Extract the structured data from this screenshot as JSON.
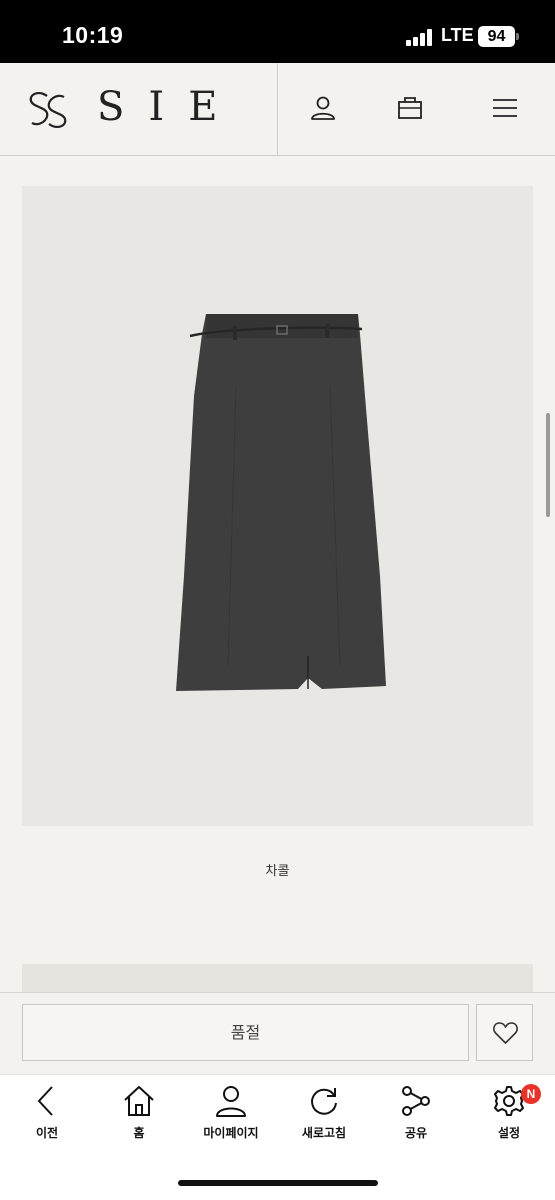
{
  "status_bar": {
    "time": "10:19",
    "network": "LTE",
    "battery": "94"
  },
  "header": {
    "logo_text": "SIE",
    "icons": [
      "account-icon",
      "shopping-bag-icon",
      "menu-icon"
    ]
  },
  "product": {
    "image_description_icon": "skirt-image",
    "color_label": "차콜"
  },
  "purchase": {
    "soldout_label": "품절",
    "wish_icon": "heart-icon"
  },
  "bottom_nav": {
    "items": [
      {
        "label": "이전",
        "icon": "back-icon"
      },
      {
        "label": "홈",
        "icon": "home-icon"
      },
      {
        "label": "마이페이지",
        "icon": "person-icon"
      },
      {
        "label": "새로고침",
        "icon": "refresh-icon"
      },
      {
        "label": "공유",
        "icon": "share-icon"
      },
      {
        "label": "설정",
        "icon": "gear-icon",
        "badge": "N"
      }
    ]
  },
  "colors": {
    "background": "#f3f2ee",
    "skirt": "#3e3e3e",
    "badge": "#e8322a"
  }
}
